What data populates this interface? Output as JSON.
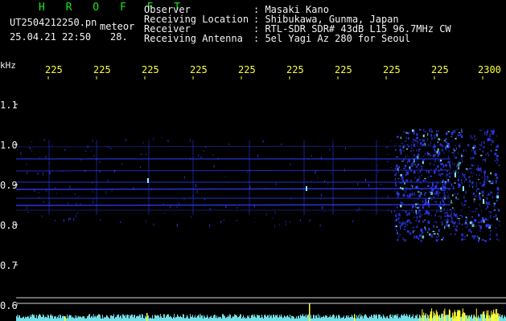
{
  "header": {
    "title": "H R O F F T",
    "filename": "UT2504212250.pn",
    "suffix": "meteor",
    "datetime": "25.04.21 22:50",
    "small_value": "28.",
    "labels": [
      "Observer",
      "Receiving Location",
      "Receiver",
      "Receiving Antenna"
    ],
    "values": [
      ": Masaki Kano",
      ": Shibukawa, Gunma, Japan",
      ": RTL-SDR SDR# 43dB L15 96.7MHz CW",
      ": 5el Yagi Az 280 for Seoul"
    ]
  },
  "axis": {
    "unit": "kHz",
    "top_ticks": [
      "225",
      "225",
      "225",
      "225",
      "225",
      "225",
      "225",
      "225",
      "225",
      "2300"
    ],
    "freq_ticks": [
      "1.1",
      "1.0",
      "0.9",
      "0.8",
      "0.7",
      "0.6"
    ]
  },
  "colors": {
    "background": "#000000",
    "text": "#f2f2f2",
    "ticks": "#ffff33",
    "title": "#19e619",
    "signal": "#2f3dff",
    "strong_signal": "#7ff7ff",
    "grid_line": "#d6d6d6"
  }
}
